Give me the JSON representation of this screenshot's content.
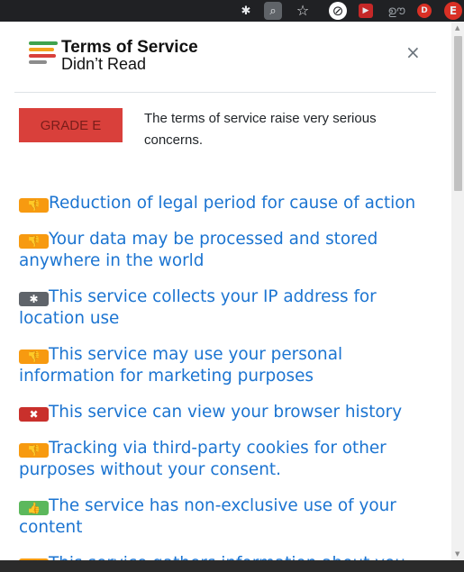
{
  "toolbar": {
    "icons": [
      {
        "name": "extension-puzzle-icon",
        "glyph": "✱"
      },
      {
        "name": "search-extension-icon",
        "glyph": "⌕"
      },
      {
        "name": "bookmark-star-icon",
        "glyph": "☆"
      },
      {
        "name": "blocker-extension-icon",
        "glyph": "⊘"
      },
      {
        "name": "red-play-extension-icon",
        "glyph": "▶"
      },
      {
        "name": "signature-extension-icon",
        "glyph": "ഊ"
      },
      {
        "name": "d-extension-icon",
        "glyph": "D"
      },
      {
        "name": "profile-avatar-icon",
        "glyph": "E"
      }
    ]
  },
  "header": {
    "title_line1": "Terms of Service",
    "title_line2": "Didn’t Read",
    "close_glyph": "×",
    "logo_colors": [
      "#3fa34d",
      "#f4a21d",
      "#d9403b",
      "#8c8c8c"
    ]
  },
  "grade": {
    "label": "GRADE E",
    "description": "The terms of service raise very serious concerns."
  },
  "points": [
    {
      "type": "bad",
      "icon": "thumbs-down-icon",
      "glyph": "👎",
      "text": "Reduction of legal period for cause of action"
    },
    {
      "type": "bad",
      "icon": "thumbs-down-icon",
      "glyph": "👎",
      "text": "Your data may be processed and stored anywhere in the world"
    },
    {
      "type": "neutral",
      "icon": "asterisk-icon",
      "glyph": "✱",
      "text": "This service collects your IP address for location use"
    },
    {
      "type": "bad",
      "icon": "thumbs-down-icon",
      "glyph": "👎",
      "text": "This service may use your personal information for marketing purposes"
    },
    {
      "type": "blocker",
      "icon": "x-mark-icon",
      "glyph": "✖",
      "text": "This service can view your browser history"
    },
    {
      "type": "bad",
      "icon": "thumbs-down-icon",
      "glyph": "👎",
      "text": "Tracking via third-party cookies for other purposes without your consent."
    },
    {
      "type": "good",
      "icon": "thumbs-up-icon",
      "glyph": "👍",
      "text": "The service has non-exclusive use of your content"
    },
    {
      "type": "bad",
      "icon": "thumbs-down-icon",
      "glyph": "👎",
      "text": "This service gathers information about you"
    }
  ],
  "colors": {
    "link": "#1b74d1",
    "grade_bg": "#d9403b",
    "bad": "#f79a10",
    "neutral": "#5f646a",
    "blocker": "#c9302c",
    "good": "#5cb85c"
  }
}
